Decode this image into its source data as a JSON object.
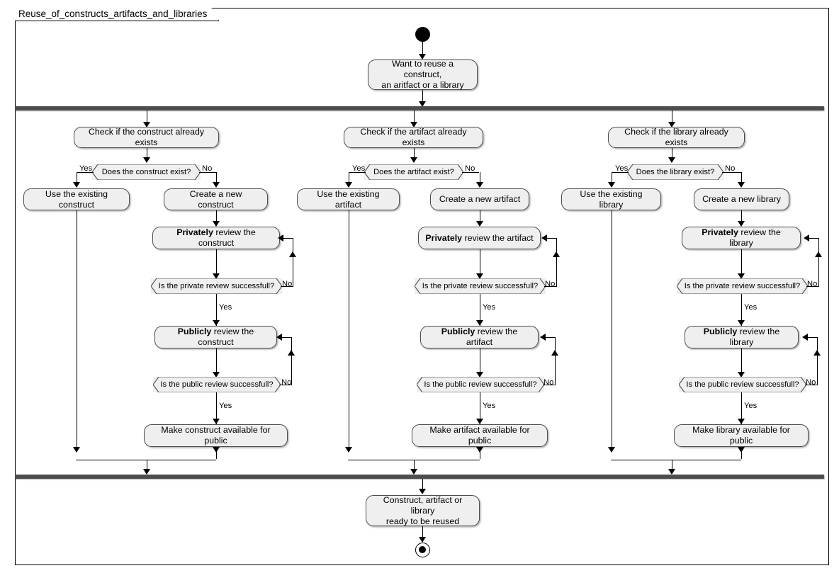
{
  "diagram": {
    "title": "Reuse_of_constructs_artifacts_and_libraries",
    "type": "uml-activity-diagram",
    "colors": {
      "node_fill": "#efefef",
      "node_border": "#4d4d4d",
      "bar": "#4d4d4d",
      "line": "#000000",
      "background": "#ffffff"
    }
  },
  "start": {
    "name": "initial-node"
  },
  "intro": {
    "line1": "Want to reuse a construct,",
    "line2": "an aritfact or a library"
  },
  "fork": {
    "label": "fork-bar"
  },
  "join": {
    "label": "join-bar"
  },
  "columns": [
    {
      "id": "construct",
      "check": "Check if the construct already exists",
      "decision": "Does the construct exist?",
      "yes": "Yes",
      "no": "No",
      "use_existing": "Use the existing construct",
      "create_new": "Create a new construct",
      "private_review_bold": "Privately",
      "private_review_rest": " review the construct",
      "private_decision": "Is the private review successfull?",
      "private_yes": "Yes",
      "private_no": "No",
      "public_review_bold": "Publicly",
      "public_review_rest": " review the construct",
      "public_decision": "Is the public review successfull?",
      "public_yes": "Yes",
      "public_no": "No",
      "make_available": "Make construct available for public"
    },
    {
      "id": "artifact",
      "check": "Check if the artifact already exists",
      "decision": "Does the artifact exist?",
      "yes": "Yes",
      "no": "No",
      "use_existing": "Use the existing artifact",
      "create_new": "Create a new artifact",
      "private_review_bold": "Privately",
      "private_review_rest": " review the artifact",
      "private_decision": "Is the private review successfull?",
      "private_yes": "Yes",
      "private_no": "No",
      "public_review_bold": "Publicly",
      "public_review_rest": " review the artifact",
      "public_decision": "Is the public review successfull?",
      "public_yes": "Yes",
      "public_no": "No",
      "make_available": "Make artifact available for public"
    },
    {
      "id": "library",
      "check": "Check if the library already exists",
      "decision": "Does the library exist?",
      "yes": "Yes",
      "no": "No",
      "use_existing": "Use the existing library",
      "create_new": "Create a new library",
      "private_review_bold": "Privately",
      "private_review_rest": " review the library",
      "private_decision": "Is the private review successfull?",
      "private_yes": "Yes",
      "private_no": "No",
      "public_review_bold": "Publicly",
      "public_review_rest": " review the library",
      "public_decision": "Is the public review successfull?",
      "public_yes": "Yes",
      "public_no": "No",
      "make_available": "Make library available for public"
    }
  ],
  "outro": {
    "line1": "Construct, artifact or library",
    "line2": "ready to be reused"
  },
  "end": {
    "name": "final-node"
  }
}
